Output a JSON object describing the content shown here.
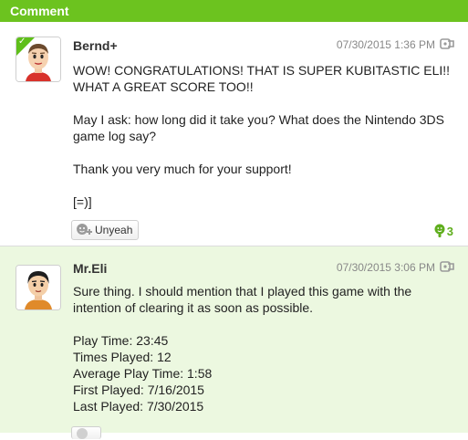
{
  "section": {
    "title": "Comment"
  },
  "comments": [
    {
      "username": "Bernd+",
      "timestamp": "07/30/2015 1:36 PM",
      "verified": true,
      "paragraphs": [
        "WOW! CONGRATULATIONS! THAT IS SUPER KUBITASTIC ELI!! WHAT A GREAT SCORE TOO!!",
        "May I ask: how long did it take you? What does the Nintendo 3DS game log say?",
        "Thank you very much for your support!",
        "[=)]"
      ],
      "yeah_label": "Unyeah",
      "yeah_count": "3"
    },
    {
      "username": "Mr.Eli",
      "timestamp": "07/30/2015 3:06 PM",
      "verified": false,
      "paragraphs": [
        "Sure thing. I should mention that I played this game with the intention of clearing it as soon as possible.",
        "Play Time: 23:45\nTimes Played: 12\nAverage Play Time: 1:58\nFirst Played: 7/16/2015\nLast Played: 7/30/2015"
      ]
    }
  ],
  "colors": {
    "header": "#6cc31f",
    "reply_background": "#ecf8e0",
    "yeah_green": "#5fae1d"
  },
  "icons": {
    "verified": "checkmark-corner-icon",
    "spoiler": "spoiler-icon",
    "yeah_button": "yeah-face-icon",
    "yeah_count": "yeah-count-icon"
  }
}
